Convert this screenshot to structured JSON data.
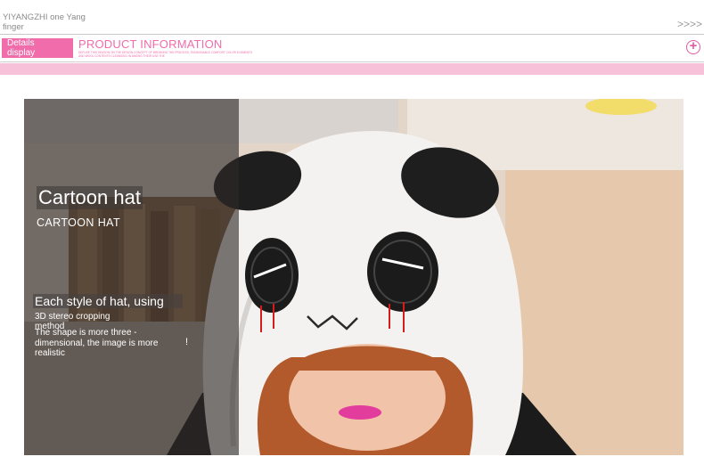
{
  "header": {
    "brand": "YIYANGZHI one Yang finger",
    "more": ">>>>",
    "details_line1": "Details",
    "details_line2": "display",
    "section_title": "PRODUCT INFORMATION",
    "section_subtitle": "DEFUSE THIS SEASON ON THE DESIGN CONCEPT OF BREAKING THE PROCESS, FASHIONABLE COMFORT COLOR ELEMENTS AND WOOL CONTENTS CLEANSING IN AMONG THEIR USE THE",
    "plus_icon": "plus-circle-icon"
  },
  "photo": {
    "title": "Cartoon hat",
    "title_caps": "CARTOON HAT",
    "feature_heading": "Each style of hat, using",
    "feature_line1": "3D stereo cropping method",
    "feature_line2": "The shape is more three -dimensional, the image is more realistic",
    "exclamation": "!"
  },
  "colors": {
    "accent_pink": "#f06caa",
    "band_pink": "#f7c1d9"
  }
}
